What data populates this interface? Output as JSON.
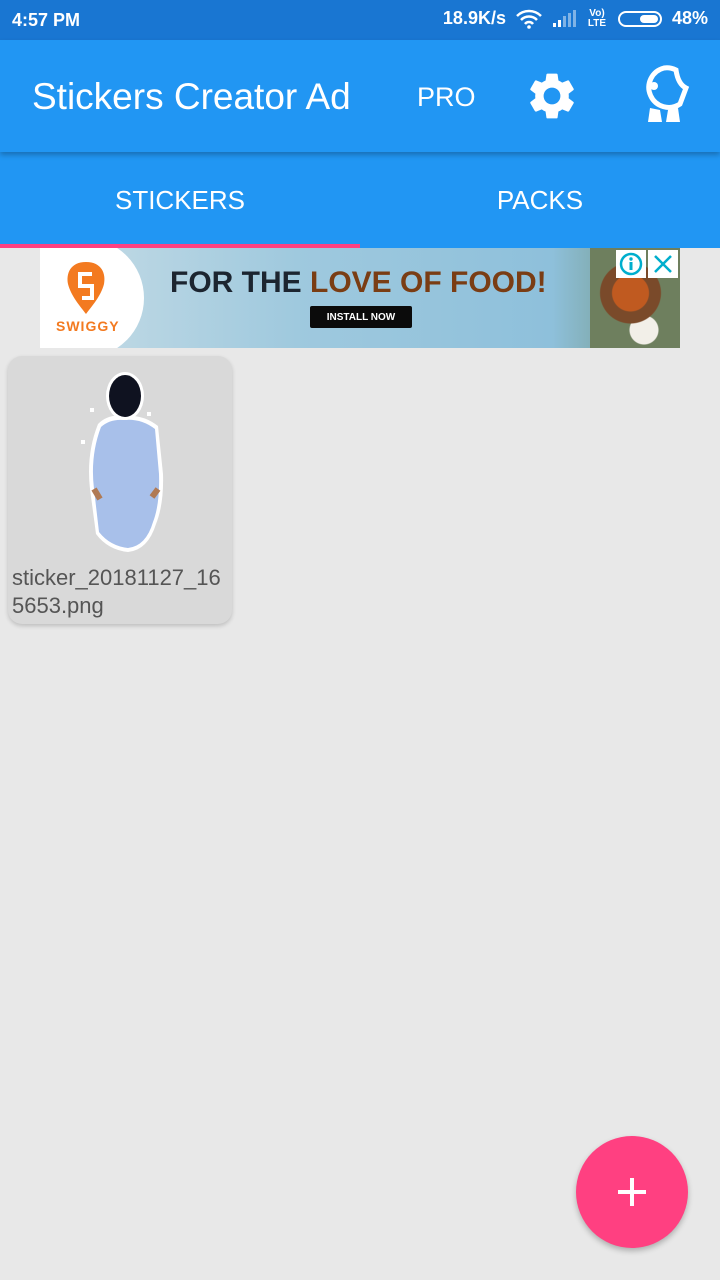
{
  "status_bar": {
    "time": "4:57 PM",
    "network_speed": "18.9K/s",
    "wifi_icon": "wifi-icon",
    "signal_icon": "signal-icon",
    "volte_label": "Vo) LTE",
    "battery_percent": "48%",
    "battery_level": 0.48
  },
  "app_bar": {
    "title": "Stickers Creator Ad",
    "pro_label": "PRO",
    "settings_icon": "gear-icon",
    "sticker_icon": "sticker-character-icon"
  },
  "tabs": [
    {
      "label": "STICKERS",
      "selected": true
    },
    {
      "label": "PACKS",
      "selected": false
    }
  ],
  "ad": {
    "brand": "SWIGGY",
    "headline_part1": "FOR THE ",
    "headline_part2": "LOVE OF FOOD!",
    "cta": "INSTALL NOW",
    "info_icon": "info-icon",
    "close_icon": "close-icon",
    "colors": {
      "brand": "#f37a20",
      "close": "#00aecd"
    }
  },
  "stickers": [
    {
      "filename": "sticker_20181127_165653.png"
    }
  ],
  "fab": {
    "icon": "plus-icon"
  },
  "colors": {
    "primary": "#2196f3",
    "primary_dark": "#1976d2",
    "accent": "#ff4081",
    "background": "#e8e8e8"
  }
}
